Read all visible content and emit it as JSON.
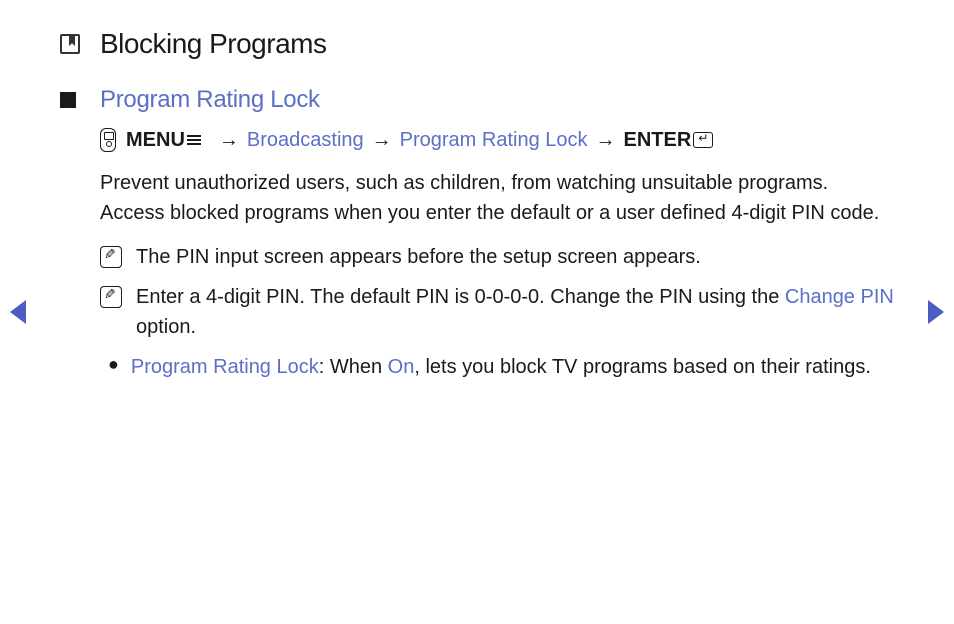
{
  "title": "Blocking Programs",
  "section": {
    "heading": "Program Rating Lock",
    "nav": {
      "menu_label": "MENU",
      "path1": "Broadcasting",
      "path2": "Program Rating Lock",
      "enter_label": "ENTER"
    },
    "description": "Prevent unauthorized users, such as children, from watching unsuitable programs. Access blocked programs when you enter the default or a user defined 4-digit PIN code.",
    "note1": "The PIN input screen appears before the setup screen appears.",
    "note2_part1": "Enter a 4-digit PIN. The default PIN is 0-0-0-0. Change the PIN using the ",
    "note2_link": "Change PIN",
    "note2_part2": " option.",
    "bullet1_label": "Program Rating Lock",
    "bullet1_sep": ": When ",
    "bullet1_value": "On",
    "bullet1_rest": ", lets you block TV programs based on their ratings."
  }
}
